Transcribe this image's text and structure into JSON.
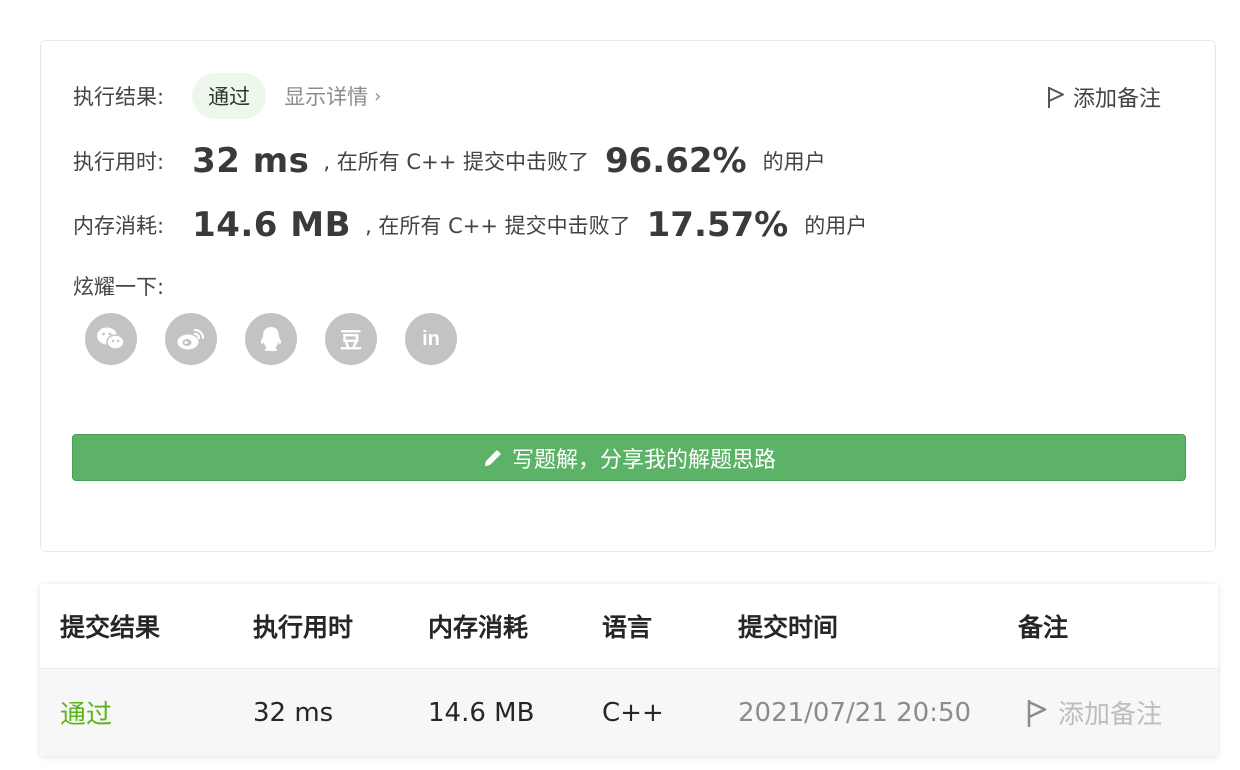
{
  "result": {
    "label": "执行结果:",
    "status": "通过",
    "detail_link": "显示详情",
    "chevron": "›",
    "add_note": "添加备注"
  },
  "runtime": {
    "label": "执行用时:",
    "value": "32 ms",
    "beat_text": ", 在所有 C++ 提交中击败了",
    "percent": "96.62%",
    "suffix": "的用户"
  },
  "memory": {
    "label": "内存消耗:",
    "value": "14.6 MB",
    "beat_text": ", 在所有 C++ 提交中击败了",
    "percent": "17.57%",
    "suffix": "的用户"
  },
  "share": {
    "label": "炫耀一下:",
    "icons": [
      "wechat-icon",
      "weibo-icon",
      "qq-icon",
      "douban-icon",
      "linkedin-icon"
    ],
    "douban_glyph": "豆",
    "linkedin_glyph": "in"
  },
  "solution_button": "写题解，分享我的解题思路",
  "table": {
    "headers": [
      "提交结果",
      "执行用时",
      "内存消耗",
      "语言",
      "提交时间",
      "备注"
    ],
    "row": {
      "result": "通过",
      "runtime": "32 ms",
      "memory": "14.6 MB",
      "language": "C++",
      "time": "2021/07/21 20:50",
      "note": "添加备注"
    }
  },
  "colors": {
    "accent_green": "#5cb368",
    "pass_green": "#5cb31a",
    "icon_gray": "#c3c3c3"
  }
}
